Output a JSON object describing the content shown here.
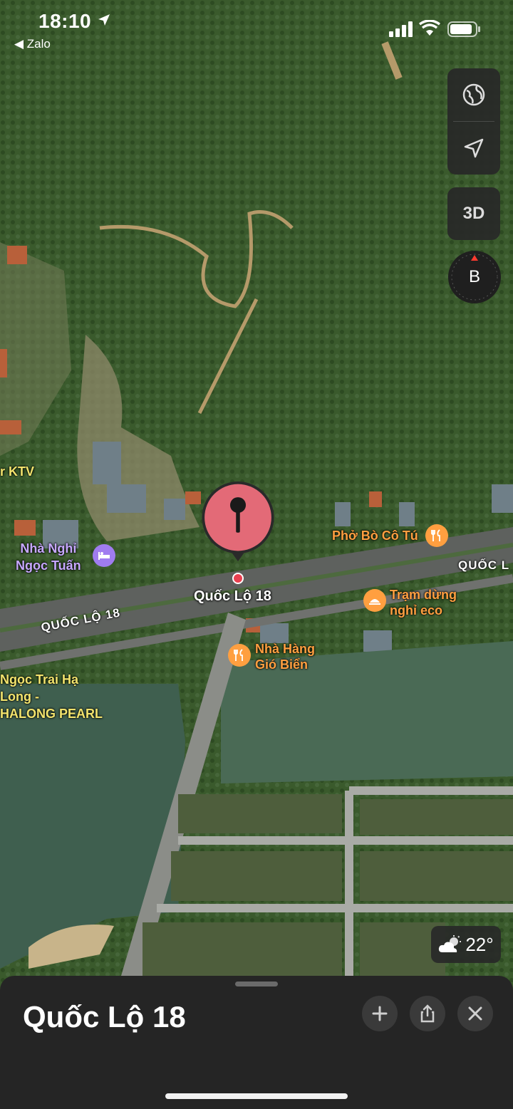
{
  "status_bar": {
    "time": "18:10",
    "back_app": "Zalo"
  },
  "map_controls": {
    "globe": "globe-icon",
    "location": "location-arrow-icon",
    "view_3d": "3D",
    "compass": "B"
  },
  "poi": {
    "ktv": "r KTV",
    "nha_nghi_line1": "Nhà Nghỉ",
    "nha_nghi_line2": "Ngọc Tuấn",
    "pho_bo": "Phở Bò Cô Tú",
    "tram_line1": "Trạm dừng",
    "tram_line2": "nghỉ eco",
    "nha_hang_line1": "Nhà Hàng",
    "nha_hang_line2": "Gió Biển",
    "pearl_line1": "Ngọc Trai Hạ",
    "pearl_line2": "Long -",
    "pearl_line3": "HALONG PEARL"
  },
  "roads": {
    "road_left": "QUỐC LỘ 18",
    "road_right": "QUỐC L"
  },
  "selected_pin_label": "Quốc Lộ 18",
  "weather": {
    "temp": "22°",
    "icon": "cloud-sun-icon"
  },
  "sheet": {
    "title": "Quốc Lộ 18",
    "add": "plus-icon",
    "share": "share-icon",
    "close": "close-icon"
  },
  "colors": {
    "pin": "#e36a77",
    "orange": "#ff9f40",
    "purple": "#a07cf0",
    "sheet_bg": "#252525"
  }
}
